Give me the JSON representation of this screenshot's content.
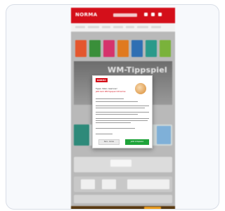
{
  "preview": {
    "site": {
      "logo": "NORMA",
      "banner": "WM-Tippspiel"
    },
    "modal": {
      "logo": "NORMA",
      "title": "Tippen. Raten. Gewinnen!",
      "subtitle": "Jetzt beim WM-Tippspiel mitmachen",
      "decline_label": "Nein, danke",
      "accept_label": "Jetzt mitspielen"
    }
  },
  "colors": {
    "brand_red": "#d40f1a",
    "accept_green": "#1fa33a"
  }
}
